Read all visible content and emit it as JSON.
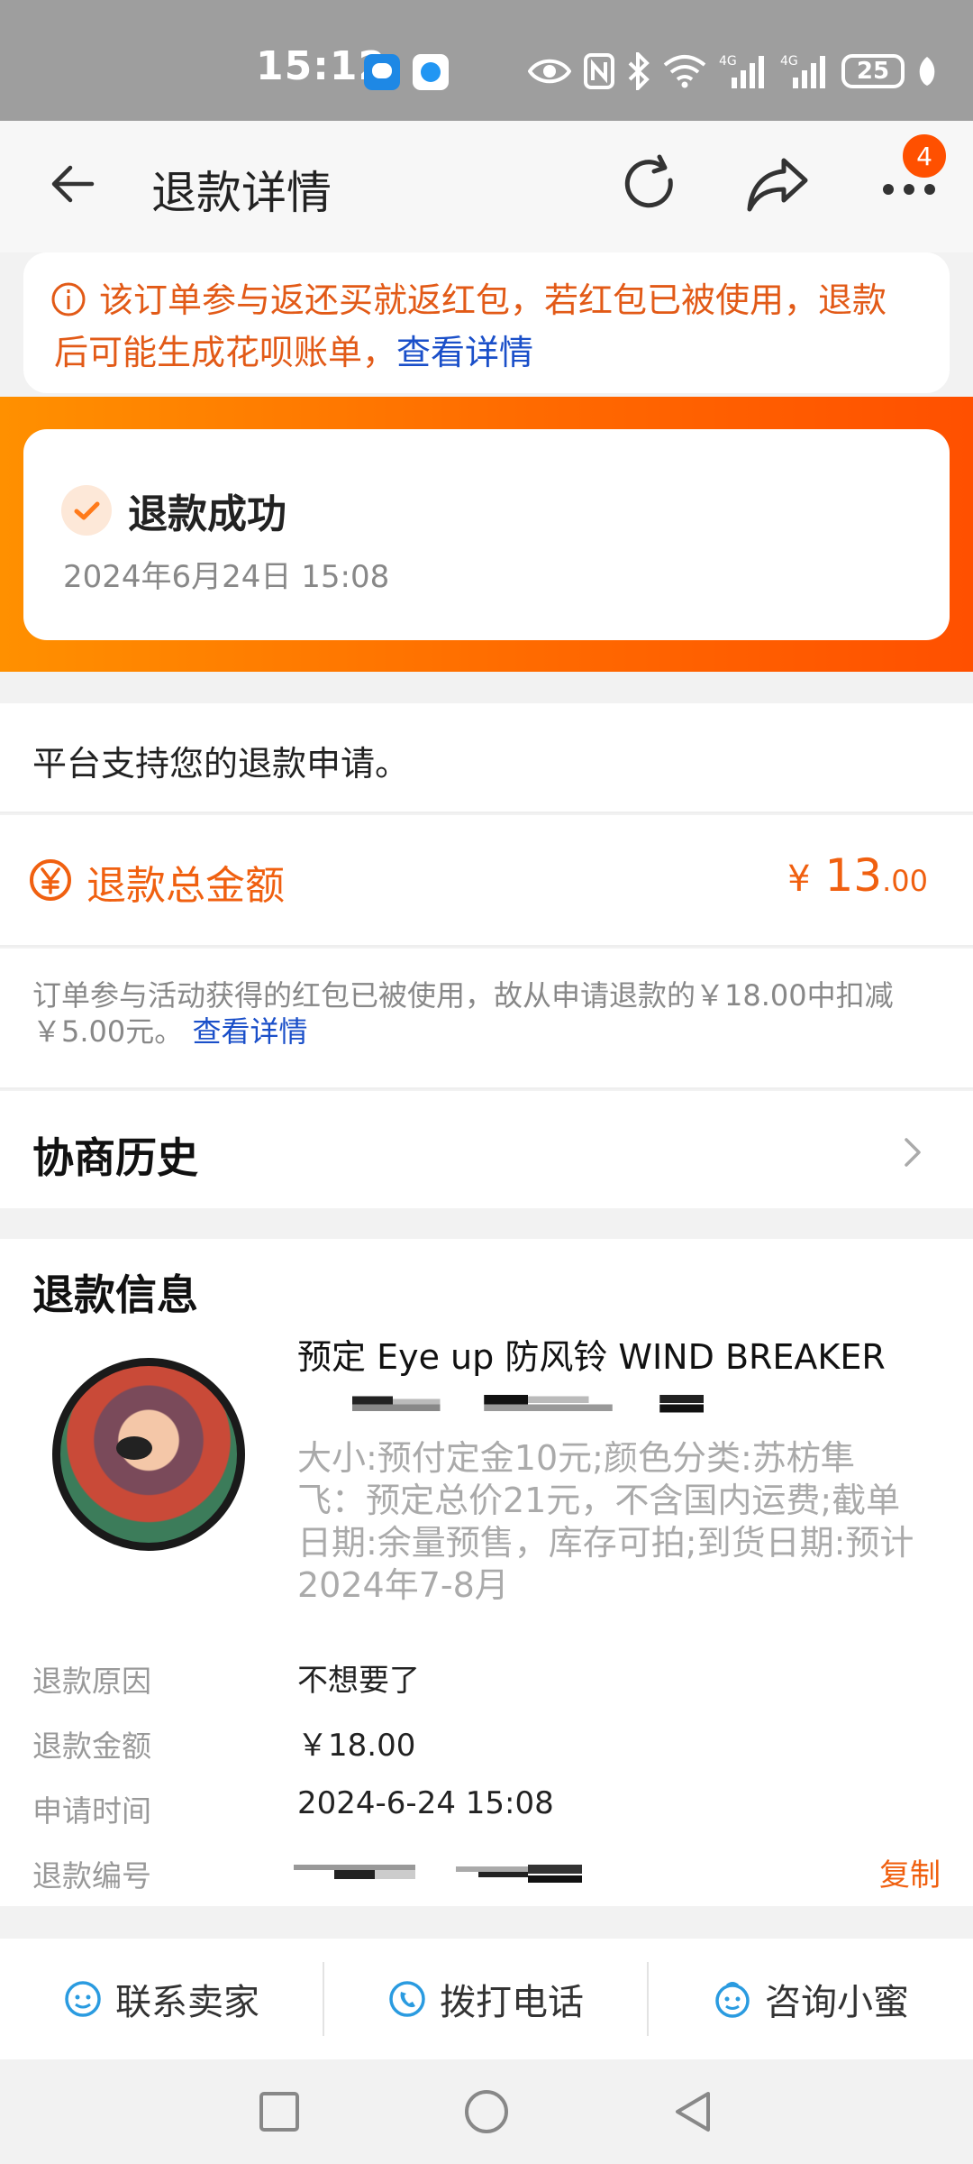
{
  "status_bar": {
    "time": "15:12",
    "battery": "25"
  },
  "nav": {
    "title": "退款详情",
    "more_badge": "4"
  },
  "notice": {
    "text": "该订单参与返还买就返红包，若红包已被使用，退款后可能生成花呗账单，",
    "link": "查看详情"
  },
  "status": {
    "title": "退款成功",
    "time": "2024年6月24日 15:08"
  },
  "support": {
    "text": "平台支持您的退款申请。"
  },
  "total": {
    "label": "退款总金额",
    "currency": "¥",
    "amount_int": "13",
    "amount_dec": ".00"
  },
  "deduct": {
    "text": "订单参与活动获得的红包已被使用，故从申请退款的￥18.00中扣减￥5.00元。",
    "link": "查看详情"
  },
  "history": {
    "title": "协商历史"
  },
  "info": {
    "title": "退款信息",
    "product_name": "预定 Eye up 防风铃 WIND BREAKER",
    "product_spec": "大小:预付定金10元;颜色分类:苏枋隼飞：预定总价21元，不含国内运费;截单日期:余量预售，库存可拍;到货日期:预计2024年7-8月",
    "rows": [
      {
        "key": "退款原因",
        "value": "不想要了"
      },
      {
        "key": "退款金额",
        "value": "￥18.00"
      },
      {
        "key": "申请时间",
        "value": "2024-6-24 15:08"
      },
      {
        "key": "退款编号",
        "value": "",
        "action": "复制"
      }
    ]
  },
  "actions": [
    {
      "label": "联系卖家",
      "icon": "seller-chat-icon"
    },
    {
      "label": "拨打电话",
      "icon": "phone-icon"
    },
    {
      "label": "咨询小蜜",
      "icon": "assistant-icon"
    }
  ],
  "colors": {
    "accent": "#ff5000",
    "price": "#f06010",
    "link": "#1a4fc9",
    "notice_text": "#e25a17"
  }
}
